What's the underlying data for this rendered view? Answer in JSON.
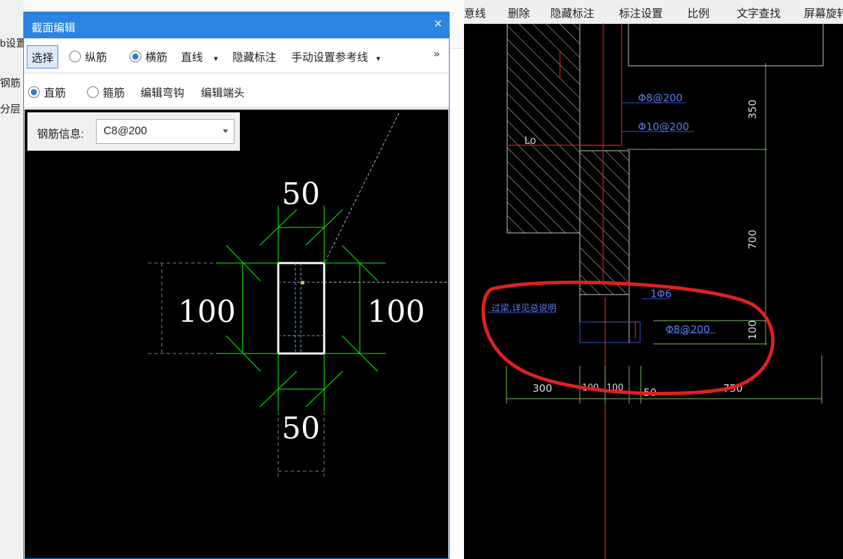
{
  "background": {
    "left_tb_1": "b设置",
    "left_tb_2": "钢筋",
    "left_tb_3": "分层"
  },
  "dialog": {
    "title": "截面编辑",
    "close": "×",
    "toolbar1": {
      "select": "选择",
      "radio_long": "纵筋",
      "radio_cross": "横筋",
      "line_type": "直线",
      "hide_dim": "隐藏标注",
      "manual_ref": "手动设置参考线",
      "more": "»"
    },
    "toolbar2": {
      "radio_straight": "直筋",
      "radio_stirrup": "箍筋",
      "edit_hook": "编辑弯钩",
      "edit_end": "编辑端头"
    },
    "rebar_info": {
      "label": "钢筋信息:",
      "value": "C8@200"
    },
    "dims": {
      "top": "50",
      "bottom": "50",
      "left": "100",
      "right": "100"
    }
  },
  "cad": {
    "menu": [
      "意线",
      "删除",
      "隐藏标注",
      "标注设置",
      "比例",
      "文字查找",
      "屏幕旋转"
    ],
    "labels": {
      "r1": "Φ8@200",
      "r2": "Φ10@200",
      "lo": "Lo",
      "d350": "350",
      "d700": "700",
      "beam": "过梁,详见总说明",
      "bar": "1Φ6",
      "r3": "Φ8@200",
      "d100": "100",
      "b300": "300",
      "b100a": "100",
      "b100b": "100",
      "b50": "50",
      "b750": "750"
    }
  },
  "colors": {
    "title_bar": "#2b84e0",
    "dim_green": "#00d000",
    "highlight": "#e02020",
    "cad_blue": "#2f5bd8"
  }
}
